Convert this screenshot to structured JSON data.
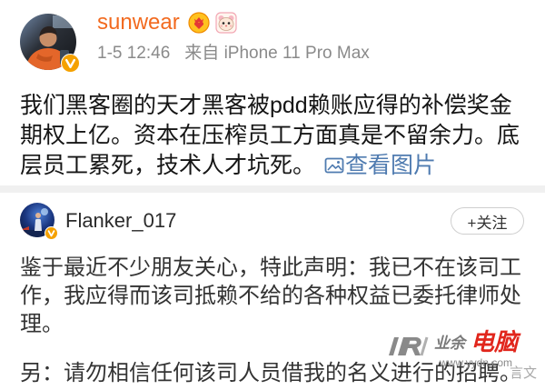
{
  "post": {
    "author": {
      "name": "sunwear",
      "verified": true,
      "badges": [
        "vip-heart-icon",
        "hamster-icon"
      ]
    },
    "time": "1-5 12:46",
    "source": "来自 iPhone 11 Pro Max",
    "text_lines": [
      "我们黑客圈的天才黑客被pdd赖账应得的补偿奖金",
      "期权上亿。资本在压榨员工方面真是不留余力。底",
      "层员工累死，技术人才坑死。"
    ],
    "view_images_label": "查看图片"
  },
  "quoted_post": {
    "author": {
      "name": "Flanker_017",
      "verified": true
    },
    "follow_label": "+关注",
    "text_lines": [
      "鉴于最近不少朋友关心，特此声明：我已不在该司工",
      "作，我应得而该司抵赖不给的各种权益已委托律师处",
      "理。"
    ],
    "note": "另：请勿相信任何该司人员借我的名义进行的招聘。"
  },
  "watermark": {
    "brand_left": "业余",
    "brand_right": "电脑",
    "url": "www.yydn.com",
    "credit": "言文"
  },
  "icons": {
    "verified": "verified-badge-icon",
    "vip": "vip-heart-icon",
    "pet": "hamster-icon",
    "view_images": "image-icon",
    "watermark_logo": "watermark-logo-icon"
  },
  "colors": {
    "accent": "#f26a1f",
    "link": "#4f7bb0",
    "verified_badge": "#f5a100",
    "divider": "#f0f0f0",
    "watermark_red": "#e1261c"
  }
}
